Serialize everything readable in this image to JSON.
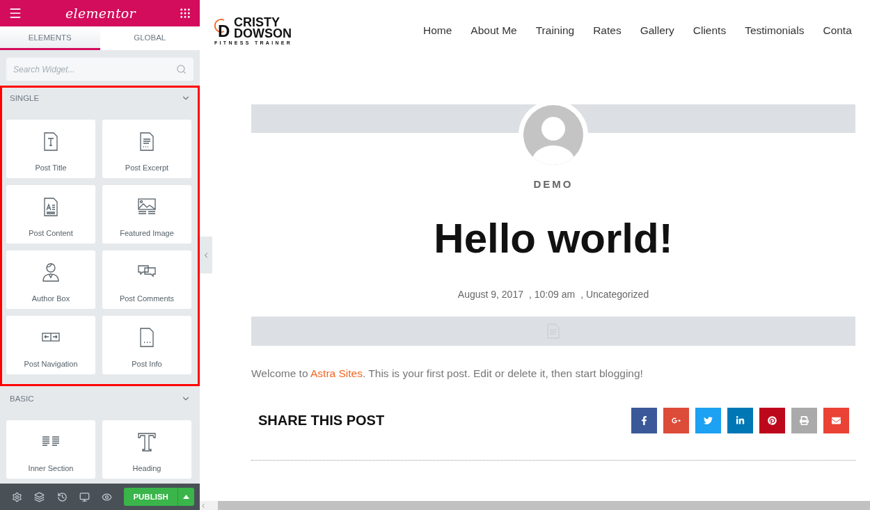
{
  "panel": {
    "brand": "elementor",
    "tabs": [
      {
        "label": "ELEMENTS",
        "selected": true
      },
      {
        "label": "GLOBAL",
        "selected": false
      }
    ],
    "search": {
      "placeholder": "Search Widget..."
    },
    "sections": [
      {
        "title": "SINGLE",
        "expanded": true,
        "highlighted": true,
        "widgets": [
          {
            "label": "Post Title"
          },
          {
            "label": "Post Excerpt"
          },
          {
            "label": "Post Content"
          },
          {
            "label": "Featured Image"
          },
          {
            "label": "Author Box"
          },
          {
            "label": "Post Comments"
          },
          {
            "label": "Post Navigation"
          },
          {
            "label": "Post Info"
          }
        ]
      },
      {
        "title": "BASIC",
        "expanded": true,
        "highlighted": false,
        "widgets": [
          {
            "label": "Inner Section"
          },
          {
            "label": "Heading"
          }
        ]
      }
    ],
    "footer": {
      "publish": "PUBLISH"
    }
  },
  "site": {
    "logo": {
      "mark": "D",
      "line1": "CRISTY",
      "line2": "DOWSON",
      "tagline": "FITNESS TRAINER"
    },
    "nav": [
      "Home",
      "About Me",
      "Training",
      "Rates",
      "Gallery",
      "Clients",
      "Testimonials",
      "Conta"
    ],
    "post": {
      "author": "DEMO",
      "title": "Hello world!",
      "meta": [
        "August 9, 2017",
        ", 10:09 am",
        ", Uncategorized"
      ],
      "body": {
        "before": "Welcome to ",
        "link": "Astra Sites",
        "after": ". This is your first post. Edit or delete it, then start blogging!"
      },
      "share_title": "SHARE THIS POST",
      "share": [
        {
          "color": "#3b5998"
        },
        {
          "color": "#dd4b39"
        },
        {
          "color": "#1da1f2"
        },
        {
          "color": "#0077b5"
        },
        {
          "color": "#bd081c"
        },
        {
          "color": "#aaaaaa"
        },
        {
          "color": "#ea4335"
        }
      ]
    }
  }
}
